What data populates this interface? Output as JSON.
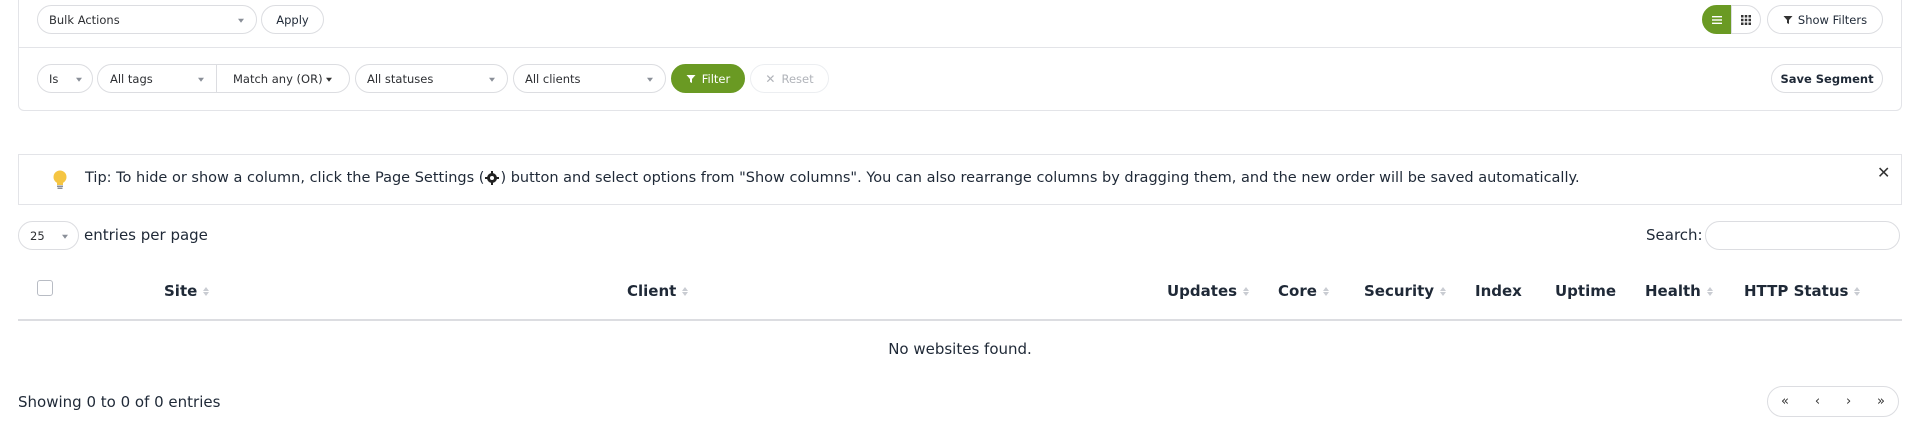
{
  "toolbar": {
    "bulk_actions": "Bulk Actions",
    "apply": "Apply",
    "show_filters": "Show Filters"
  },
  "filters": {
    "is": "Is",
    "tags": "All tags",
    "match": "Match any (OR)",
    "statuses": "All statuses",
    "clients": "All clients",
    "filter": "Filter",
    "reset": "Reset",
    "save_segment": "Save Segment"
  },
  "tip": {
    "prefix": "Tip: To hide or show a column, click the Page Settings (",
    "suffix": ") button and select options from \"Show columns\". You can also rearrange columns by dragging them, and the new order will be saved automatically."
  },
  "table": {
    "page_length": "25",
    "entries_per_page": "entries per page",
    "search_label": "Search:",
    "columns": {
      "site": "Site",
      "client": "Client",
      "updates": "Updates",
      "core": "Core",
      "security": "Security",
      "index": "Index",
      "uptime": "Uptime",
      "health": "Health",
      "http_status": "HTTP Status"
    },
    "empty": "No websites found.",
    "info": "Showing 0 to 0 of 0 entries"
  },
  "pagination": {
    "first": "«",
    "prev": "‹",
    "next": "›",
    "last": "»"
  },
  "colors": {
    "accent": "#6a9a23",
    "border": "#dcdde1"
  }
}
